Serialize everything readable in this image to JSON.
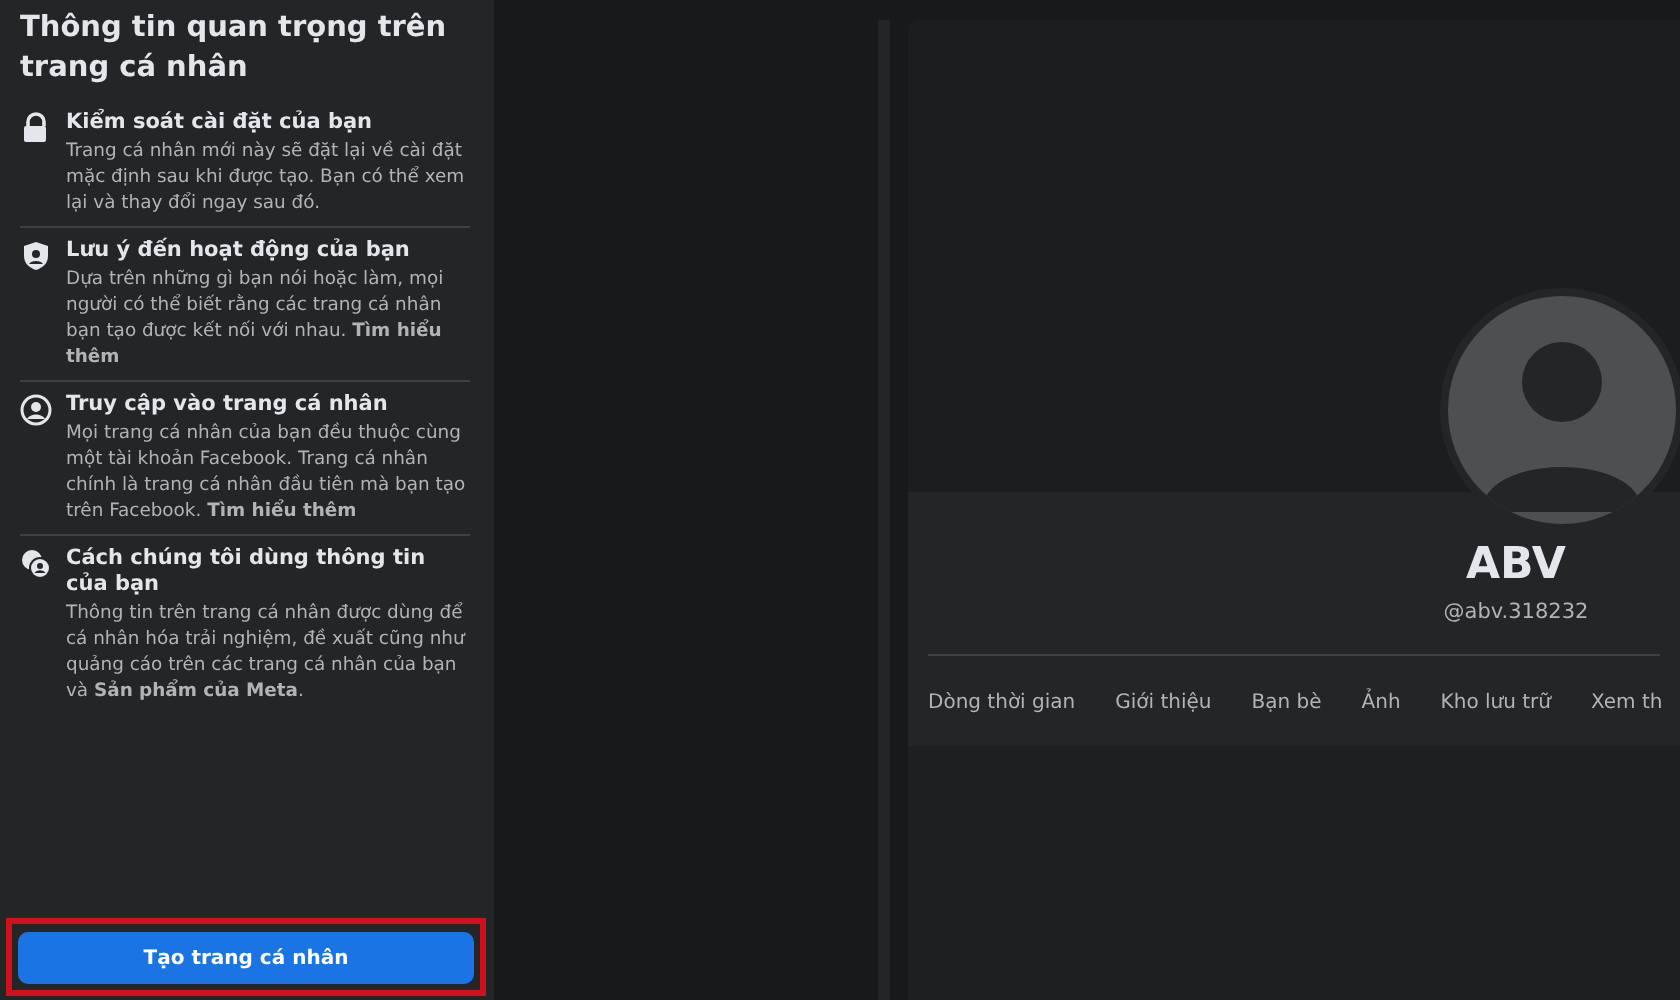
{
  "panel": {
    "title": "Thông tin quan trọng trên trang cá nhân",
    "items": [
      {
        "kind": "lock",
        "title": "Kiểm soát cài đặt của bạn",
        "text": "Trang cá nhân mới này sẽ đặt lại về cài đặt mặc định sau khi được tạo. Bạn có thể xem lại và thay đổi ngay sau đó."
      },
      {
        "kind": "shield",
        "title": "Lưu ý đến hoạt động của bạn",
        "text": "Dựa trên những gì bạn nói hoặc làm, mọi người có thể biết rằng các trang cá nhân bạn tạo được kết nối với nhau. **Tìm hiểu thêm**"
      },
      {
        "kind": "person",
        "title": "Truy cập vào trang cá nhân",
        "text": "Mọi trang cá nhân của bạn đều thuộc cùng một tài khoản Facebook. Trang cá nhân chính là trang cá nhân đầu tiên mà bạn tạo trên Facebook. **Tìm hiểu thêm**"
      },
      {
        "kind": "people",
        "title": "Cách chúng tôi dùng thông tin của bạn",
        "text": "Thông tin trên trang cá nhân được dùng để cá nhân hóa trải nghiệm, đề xuất cũng như quảng cáo trên các trang cá nhân của bạn và **Sản phẩm của Meta**."
      }
    ],
    "button": "Tạo trang cá nhân",
    "highlighted": true
  },
  "preview": {
    "name": "ABV",
    "username": "@abv.318232",
    "tabs": [
      "Dòng thời gian",
      "Giới thiệu",
      "Bạn bè",
      "Ảnh",
      "Kho lưu trữ",
      "Xem th"
    ]
  }
}
